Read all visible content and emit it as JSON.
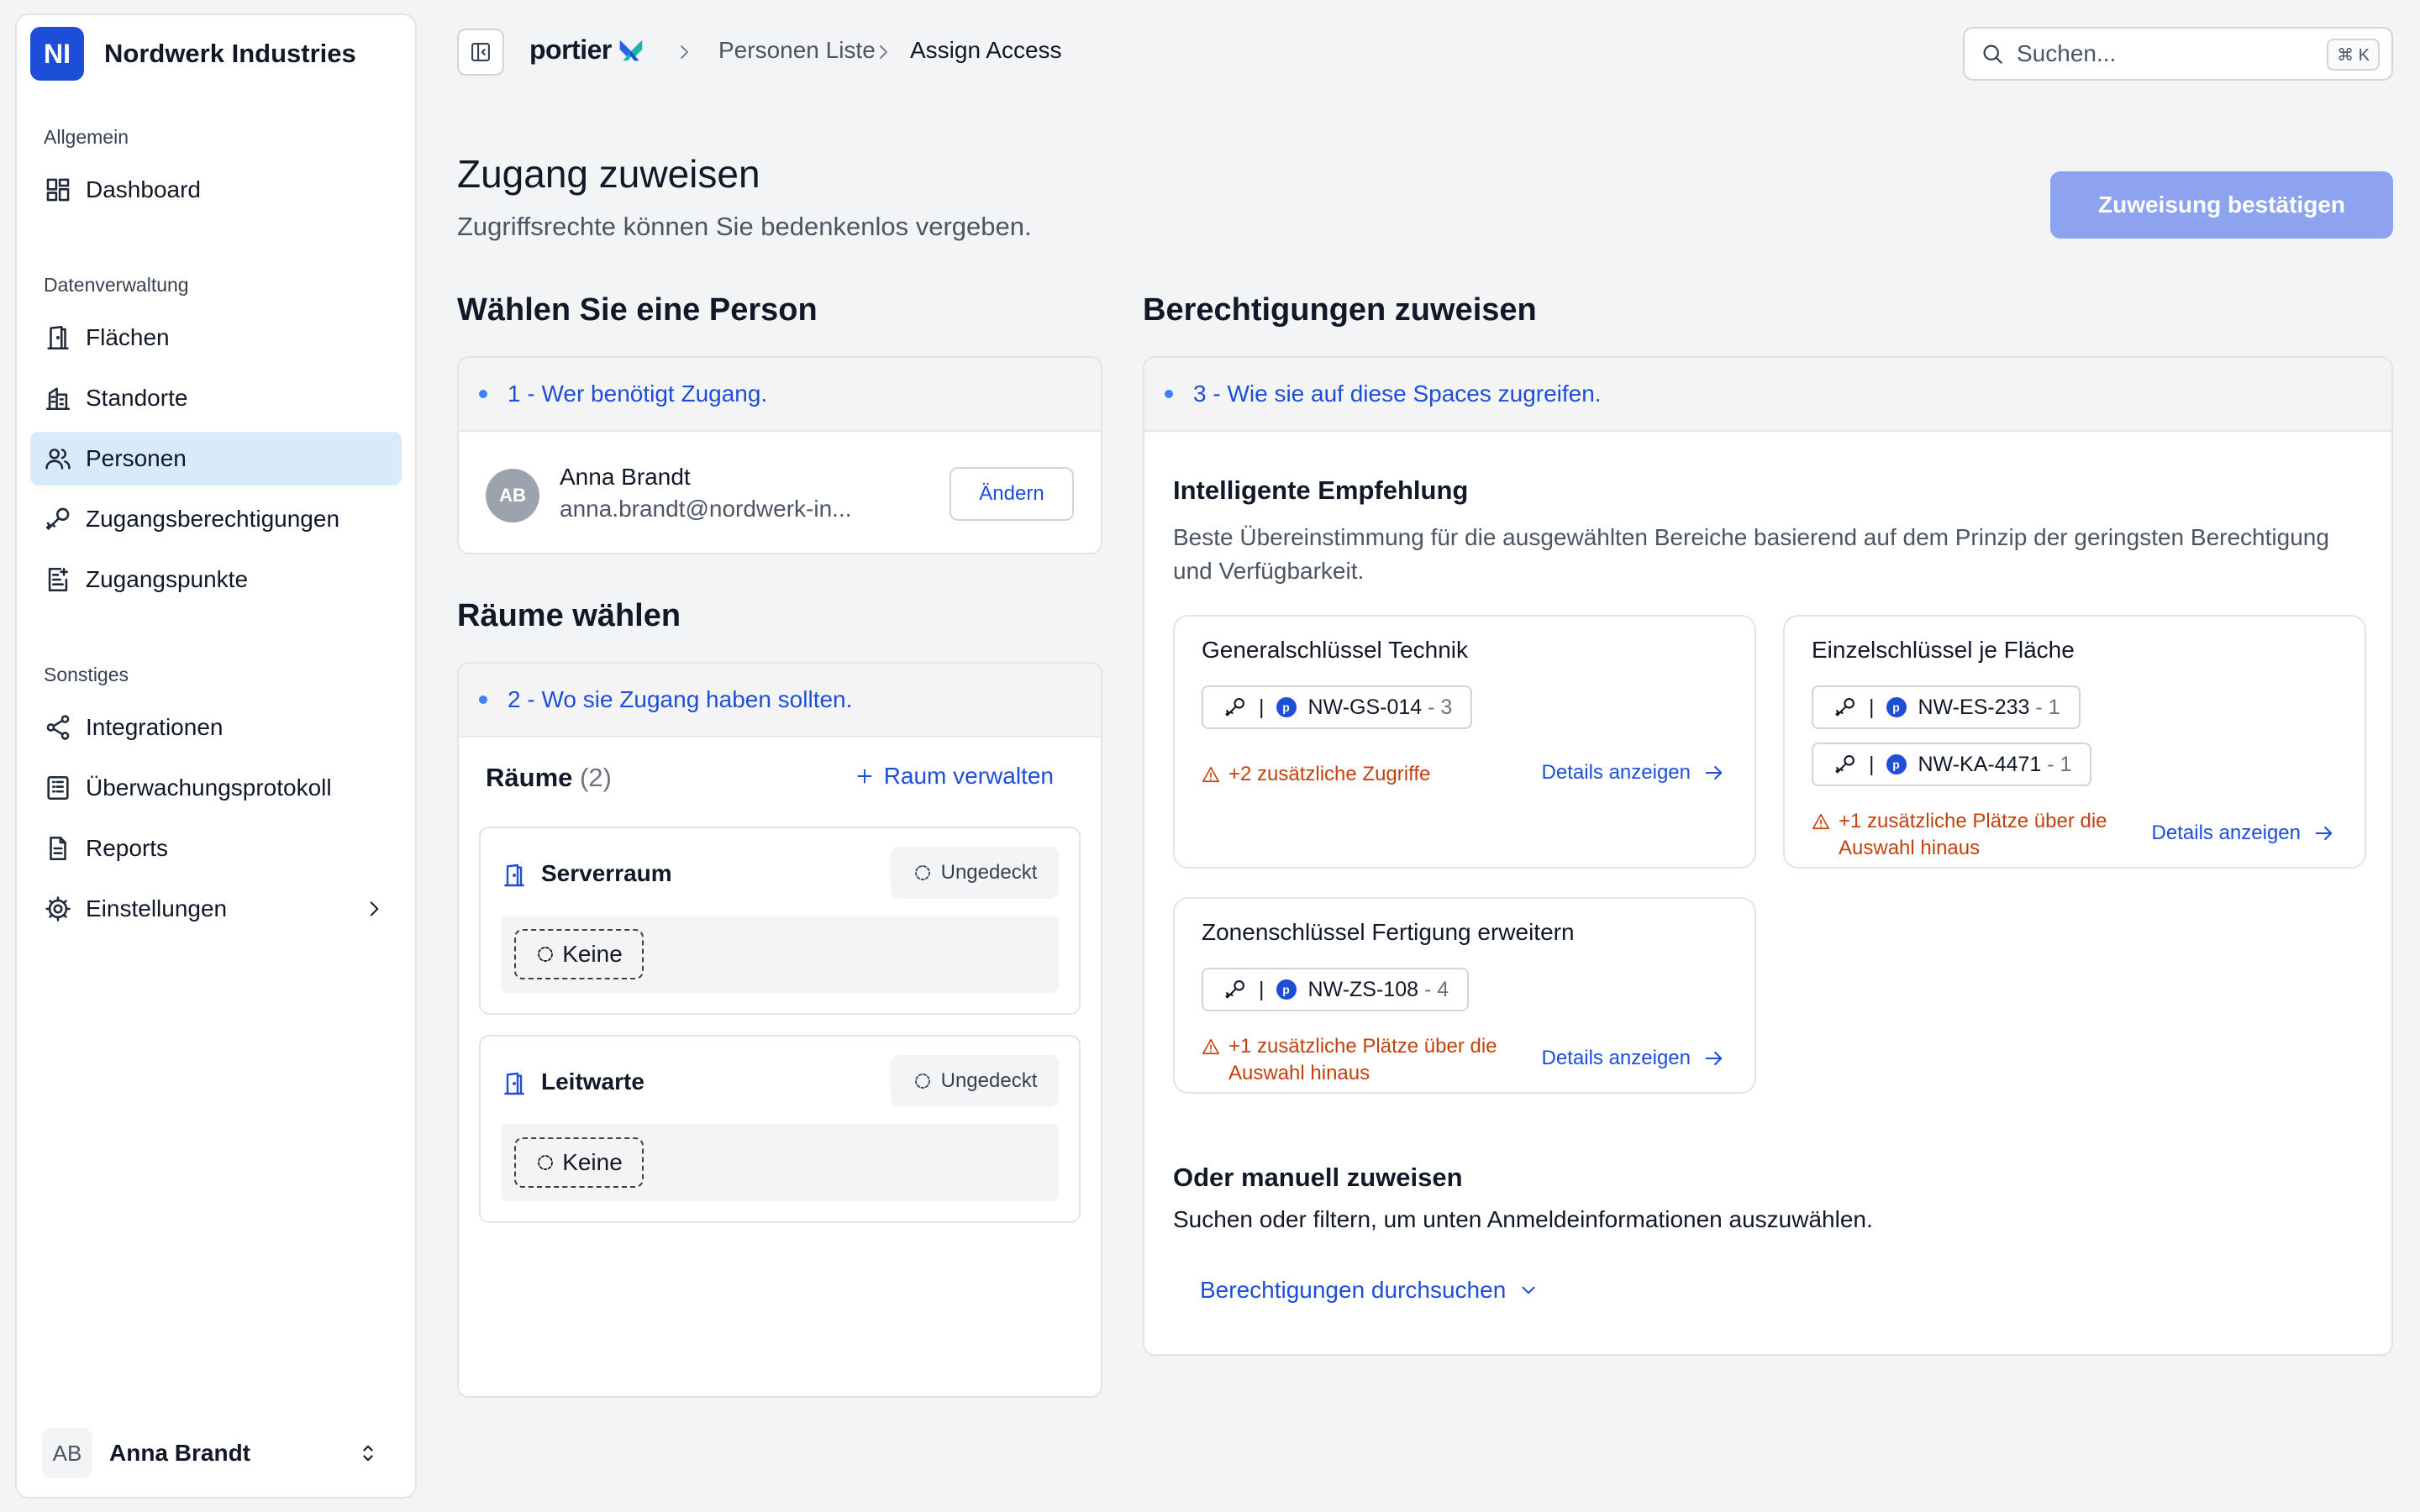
{
  "org": {
    "logo": "NI",
    "name": "Nordwerk Industries"
  },
  "sidebar": {
    "sections": [
      {
        "title": "Allgemein"
      },
      {
        "title": "Datenverwaltung"
      },
      {
        "title": "Sonstiges"
      }
    ],
    "items": [
      {
        "label": "Dashboard",
        "icon": "dashboard-icon"
      },
      {
        "label": "Flächen",
        "icon": "door-icon"
      },
      {
        "label": "Standorte",
        "icon": "building-icon"
      },
      {
        "label": "Personen",
        "icon": "users-icon",
        "active": true
      },
      {
        "label": "Zugangsberechtigungen",
        "icon": "key-icon"
      },
      {
        "label": "Zugangspunkte",
        "icon": "access-point-icon"
      },
      {
        "label": "Integrationen",
        "icon": "share-icon"
      },
      {
        "label": "Überwachungsprotokoll",
        "icon": "log-icon"
      },
      {
        "label": "Reports",
        "icon": "report-icon"
      },
      {
        "label": "Einstellungen",
        "icon": "gear-icon"
      }
    ],
    "user": {
      "initials": "AB",
      "name": "Anna Brandt"
    }
  },
  "topbar": {
    "brand": "portier",
    "breadcrumbs": [
      "Personen Liste",
      "Assign Access"
    ],
    "search": {
      "placeholder": "Suchen...",
      "shortcut": "⌘ K"
    }
  },
  "header": {
    "title": "Zugang zuweisen",
    "subtitle": "Zugriffsrechte können Sie bedenkenlos vergeben.",
    "confirm_label": "Zuweisung bestätigen"
  },
  "person_section": {
    "title": "Wählen Sie eine Person",
    "step": "1 - Wer benötigt Zugang.",
    "person": {
      "initials": "AB",
      "name": "Anna Brandt",
      "email": "anna.brandt@nordwerk-in..."
    },
    "change_label": "Ändern"
  },
  "rooms_section": {
    "title": "Räume wählen",
    "step": "2 - Wo sie Zugang haben sollten.",
    "label": "Räume",
    "count": "(2)",
    "manage_label": "Raum verwalten",
    "rooms": [
      {
        "name": "Serverraum",
        "status": "Ungedeckt",
        "assigned": "Keine"
      },
      {
        "name": "Leitwarte",
        "status": "Ungedeckt",
        "assigned": "Keine"
      }
    ]
  },
  "permissions_section": {
    "title": "Berechtigungen zuweisen",
    "step": "3 - Wie sie auf diese Spaces zugreifen.",
    "recommendation": {
      "title": "Intelligente Empfehlung",
      "subtitle": "Beste Übereinstimmung für die ausgewählten Bereiche basierend auf dem Prinzip der geringsten Berechtigung und Verfügbarkeit.",
      "cards": [
        {
          "title": "Generalschlüssel Technik",
          "keys": [
            {
              "code": "NW-GS-014",
              "count": "- 3"
            }
          ],
          "warning": "+2 zusätzliche Zugriffe",
          "details": "Details anzeigen"
        },
        {
          "title": "Einzelschlüssel je Fläche",
          "keys": [
            {
              "code": "NW-ES-233",
              "count": "- 1"
            },
            {
              "code": "NW-KA-4471",
              "count": "- 1"
            }
          ],
          "warning": "+1 zusätzliche Plätze über die Auswahl hinaus",
          "details": "Details anzeigen"
        },
        {
          "title": "Zonenschlüssel Fertigung erweitern",
          "keys": [
            {
              "code": "NW-ZS-108",
              "count": "- 4"
            }
          ],
          "warning": "+1 zusätzliche Plätze über die Auswahl hinaus",
          "details": "Details anzeigen"
        }
      ]
    },
    "manual": {
      "title": "Oder manuell zuweisen",
      "subtitle": "Suchen oder filtern, um unten Anmeldeinformationen auszuwählen.",
      "browse_label": "Berechtigungen durchsuchen"
    }
  },
  "colors": {
    "accent": "#1d4ed8",
    "confirm_button": "#8da3ef",
    "active_nav": "#d8ebfb",
    "warning": "#c2410c"
  }
}
